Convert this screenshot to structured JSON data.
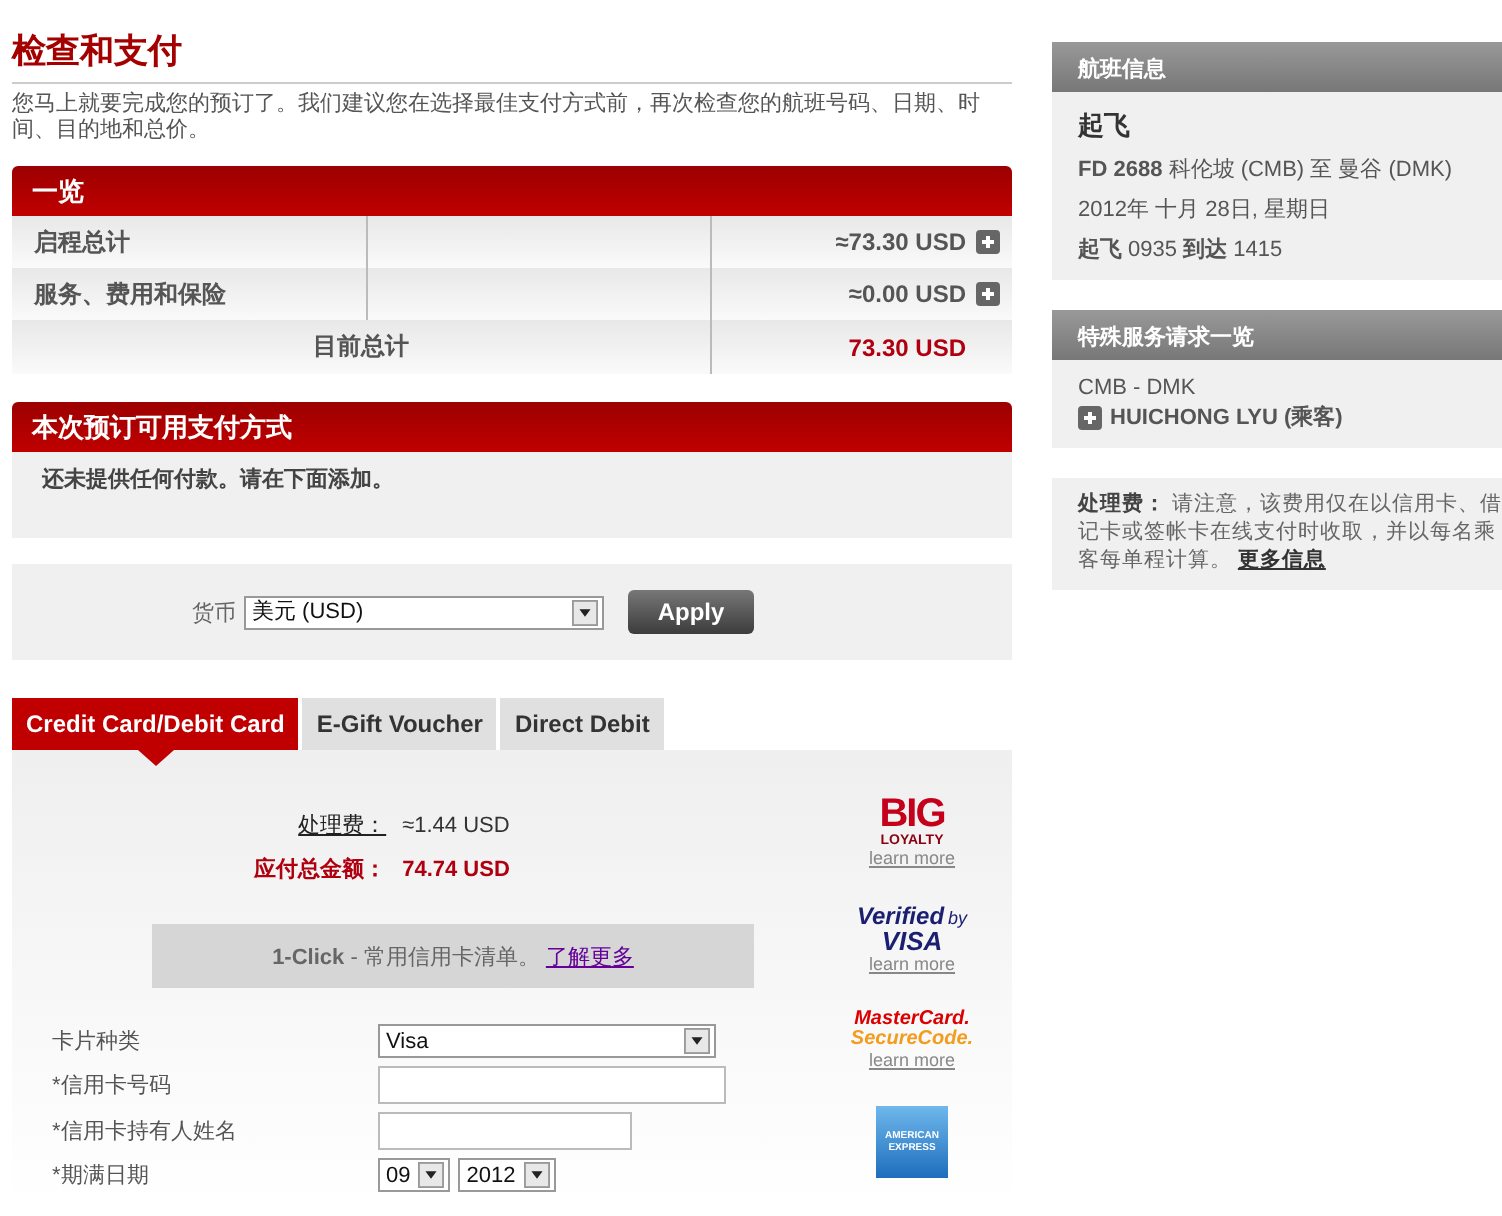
{
  "page_title": "检查和支付",
  "intro": "您马上就要完成您的预订了。我们建议您在选择最佳支付方式前，再次检查您的航班号码、日期、时间、目的地和总价。",
  "summary": {
    "title": "一览",
    "rows": [
      {
        "label": "启程总计",
        "amount": "≈73.30 USD",
        "expanded": false
      },
      {
        "label": "服务、费用和保险",
        "amount": "≈0.00 USD",
        "expanded": false
      }
    ],
    "total": {
      "label": "目前总计",
      "amount": "73.30 USD"
    }
  },
  "payment_methods": {
    "title": "本次预订可用支付方式",
    "message": "还未提供任何付款。请在下面添加。"
  },
  "currency": {
    "label": "货币",
    "value": "美元 (USD)",
    "button": "Apply"
  },
  "tabs": [
    {
      "label": "Credit Card/Debit Card",
      "selected": true
    },
    {
      "label": "E-Gift Voucher",
      "selected": false
    },
    {
      "label": "Direct Debit",
      "selected": false
    }
  ],
  "fees": [
    {
      "kind": "fee",
      "label": "处理费：",
      "value": "≈1.44 USD"
    },
    {
      "kind": "total",
      "label": "应付总金额：",
      "value": "74.74 USD"
    }
  ],
  "one_click": {
    "text": "**1-Click** - 常用信用卡清单。",
    "link": "了解更多"
  },
  "card_form": [
    {
      "kind": "select",
      "label": "卡片种类",
      "value": "Visa"
    },
    {
      "kind": "text",
      "label": "*信用卡号码"
    },
    {
      "kind": "text",
      "label": "*信用卡持有人姓名"
    },
    {
      "kind": "date",
      "label": "*期满日期",
      "values": [
        "09",
        "2012"
      ]
    }
  ],
  "security_logos": [
    {
      "kind": "big",
      "lines": [
        "BIG",
        "LOYALTY"
      ],
      "link": "learn more"
    },
    {
      "kind": "vbv",
      "lines": [
        "Verified",
        "by",
        "VISA"
      ],
      "link": "learn more"
    },
    {
      "kind": "mc",
      "lines": [
        "MasterCard.",
        "SecureCode."
      ],
      "link": "learn more"
    },
    {
      "kind": "amex",
      "lines": [
        "AMERICAN",
        "EXPRESS"
      ]
    }
  ],
  "flight_info": {
    "title": "航班信息",
    "heading": "起飞",
    "route": "**FD 2688** 科伦坡 (CMB) 至 曼谷 (DMK)",
    "date": "2012年 十月 28日, 星期日",
    "times": "**起飞** 0935 **到达** 1415"
  },
  "ssr": {
    "title": "特殊服务请求一览",
    "segment": "CMB - DMK",
    "passenger": "HUICHONG LYU (乘客)",
    "expanded": false
  },
  "fee_note": {
    "text": "**处理费：** 请注意，该费用仅在以信用卡、借记卡或签帐卡在线支付时收取，并以每名乘客每单程计算。",
    "link": "更多信息"
  }
}
